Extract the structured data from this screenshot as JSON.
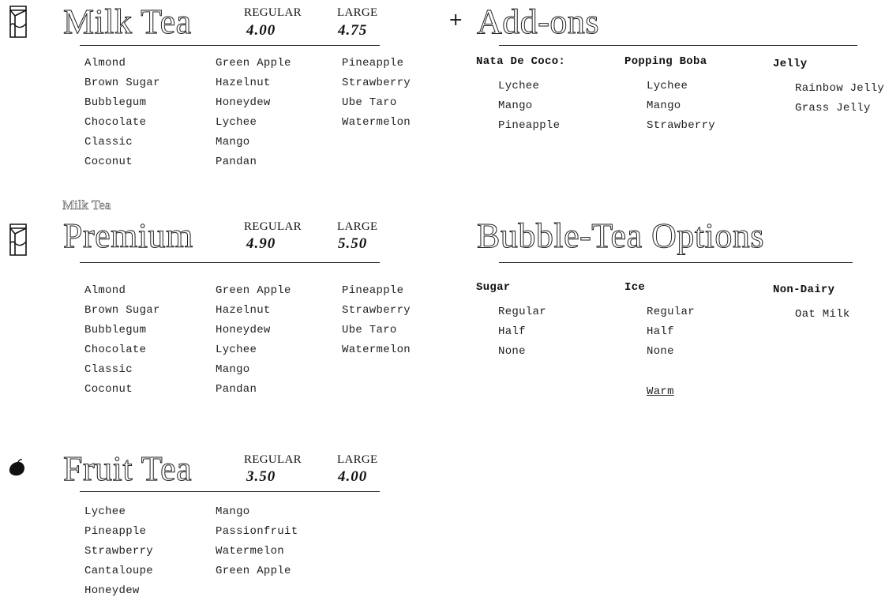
{
  "milk_tea": {
    "title": "Milk Tea",
    "regular_label": "REGULAR",
    "regular_price": "4.00",
    "large_label": "LARGE",
    "large_price": "4.75",
    "col1": [
      "Almond",
      "Brown Sugar",
      "Bubblegum",
      "Chocolate",
      "Classic",
      "Coconut"
    ],
    "col2": [
      "Green Apple",
      "Hazelnut",
      "Honeydew",
      "Lychee",
      "Mango",
      "Pandan"
    ],
    "col3": [
      "Pineapple",
      "Strawberry",
      "Ube Taro",
      "Watermelon"
    ]
  },
  "premium": {
    "kicker": "Milk Tea",
    "title": "Premium",
    "regular_label": "REGULAR",
    "regular_price": "4.90",
    "large_label": "LARGE",
    "large_price": "5.50",
    "col1": [
      "Almond",
      "Brown Sugar",
      "Bubblegum",
      "Chocolate",
      "Classic",
      "Coconut"
    ],
    "col2": [
      "Green Apple",
      "Hazelnut",
      "Honeydew",
      "Lychee",
      "Mango",
      "Pandan"
    ],
    "col3": [
      "Pineapple",
      "Strawberry",
      "Ube Taro",
      "Watermelon"
    ]
  },
  "fruit_tea": {
    "title": "Fruit Tea",
    "regular_label": "REGULAR",
    "regular_price": "3.50",
    "large_label": "LARGE",
    "large_price": "4.00",
    "col1": [
      "Lychee",
      "Pineapple",
      "Strawberry",
      "Cantaloupe",
      "Honeydew"
    ],
    "col2": [
      "Mango",
      "Passionfruit",
      "Watermelon",
      "Green Apple"
    ]
  },
  "addons": {
    "plus": "+",
    "title": "Add-ons",
    "nata_title": "Nata De Coco:",
    "nata_items": [
      "Lychee",
      "Mango",
      "Pineapple"
    ],
    "boba_title": "Popping Boba",
    "boba_items": [
      "Lychee",
      "Mango",
      "Strawberry"
    ],
    "jelly_title": "Jelly",
    "jelly_items": [
      "Rainbow Jelly",
      "Grass Jelly"
    ]
  },
  "options": {
    "title": "Bubble-Tea Options",
    "sugar_title": "Sugar",
    "sugar_items": [
      "Regular",
      "Half",
      "None"
    ],
    "ice_title": "Ice",
    "ice_items": [
      "Regular",
      "Half",
      "None"
    ],
    "warm_label": "Warm",
    "nondairy_title": "Non-Dairy",
    "nondairy_items": [
      "Oat Milk"
    ]
  },
  "icons": {
    "milk_carton": "milk-carton-icon",
    "fruit": "fruit-icon"
  }
}
